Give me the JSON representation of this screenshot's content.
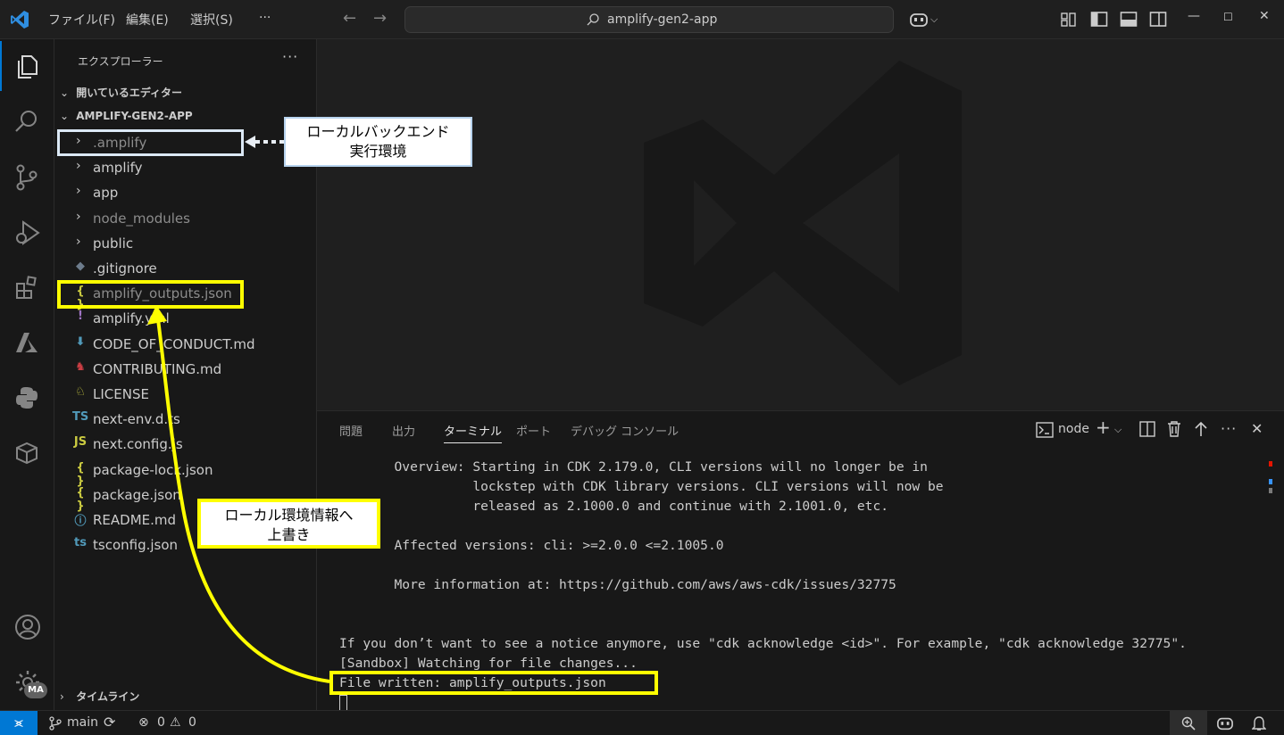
{
  "titlebar": {
    "menus": [
      "ファイル(F)",
      "編集(E)",
      "選択(S)",
      "···"
    ],
    "search_text": "amplify-gen2-app",
    "window_controls": [
      "—",
      "☐",
      "✕"
    ]
  },
  "sidebar": {
    "title": "エクスプローラー",
    "more": "···",
    "open_editors": "開いているエディター",
    "project": "AMPLIFY-GEN2-APP",
    "timeline": "タイムライン",
    "tree": [
      {
        "label": ".amplify",
        "kind": "folder",
        "dim": true
      },
      {
        "label": "amplify",
        "kind": "folder",
        "dim": false
      },
      {
        "label": "app",
        "kind": "folder",
        "dim": false
      },
      {
        "label": "node_modules",
        "kind": "folder",
        "dim": true
      },
      {
        "label": "public",
        "kind": "folder",
        "dim": false
      },
      {
        "label": ".gitignore",
        "kind": "file",
        "icon": "◆",
        "icon_color": "#6d7c8c",
        "dim": false
      },
      {
        "label": "amplify_outputs.json",
        "kind": "file",
        "icon": "{ }",
        "icon_color": "#cbcb41",
        "dim": true
      },
      {
        "label": "amplify.yml",
        "kind": "file",
        "icon": "!",
        "icon_color": "#a074c4",
        "dim": false
      },
      {
        "label": "CODE_OF_CONDUCT.md",
        "kind": "file",
        "icon": "⬇",
        "icon_color": "#519aba",
        "dim": false
      },
      {
        "label": "CONTRIBUTING.md",
        "kind": "file",
        "icon": "♞",
        "icon_color": "#cc3e44",
        "dim": false
      },
      {
        "label": "LICENSE",
        "kind": "file",
        "icon": "♘",
        "icon_color": "#cbcb41",
        "dim": false
      },
      {
        "label": "next-env.d.ts",
        "kind": "file",
        "icon": "TS",
        "icon_color": "#519aba",
        "dim": false
      },
      {
        "label": "next.config.js",
        "kind": "file",
        "icon": "JS",
        "icon_color": "#cbcb41",
        "dim": false
      },
      {
        "label": "package-lock.json",
        "kind": "file",
        "icon": "{ }",
        "icon_color": "#cbcb41",
        "dim": false
      },
      {
        "label": "package.json",
        "kind": "file",
        "icon": "{ }",
        "icon_color": "#cbcb41",
        "dim": false
      },
      {
        "label": "README.md",
        "kind": "file",
        "icon": "ⓘ",
        "icon_color": "#519aba",
        "dim": false
      },
      {
        "label": "tsconfig.json",
        "kind": "file",
        "icon": "ts",
        "icon_color": "#519aba",
        "dim": false
      }
    ]
  },
  "panel": {
    "tabs": [
      "問題",
      "出力",
      "ターミナル",
      "ポート",
      "デバッグ コンソール"
    ],
    "active_tab": "ターミナル",
    "terminal_name": "node",
    "terminal_lines": [
      "       Overview: Starting in CDK 2.179.0, CLI versions will no longer be in",
      "                 lockstep with CDK library versions. CLI versions will now be",
      "                 released as 2.1000.0 and continue with 2.1001.0, etc.",
      "",
      "       Affected versions: cli: >=2.0.0 <=2.1005.0",
      "",
      "       More information at: https://github.com/aws/aws-cdk/issues/32775",
      "",
      "",
      "If you don’t want to see a notice anymore, use \"cdk acknowledge <id>\". For example, \"cdk acknowledge 32775\".",
      "[Sandbox] Watching for file changes...",
      "File written: amplify_outputs.json"
    ]
  },
  "statusbar": {
    "branch": "main",
    "errors": "0",
    "warnings": "0",
    "avatar_badge": "MA"
  },
  "annotations": {
    "callout_local_backend": "ローカルバックエンド\n実行環境",
    "callout_overwrite": "ローカル環境情報へ\n上書き"
  },
  "colors": {
    "accent": "#0078d4",
    "highlight": "#ffff00"
  }
}
